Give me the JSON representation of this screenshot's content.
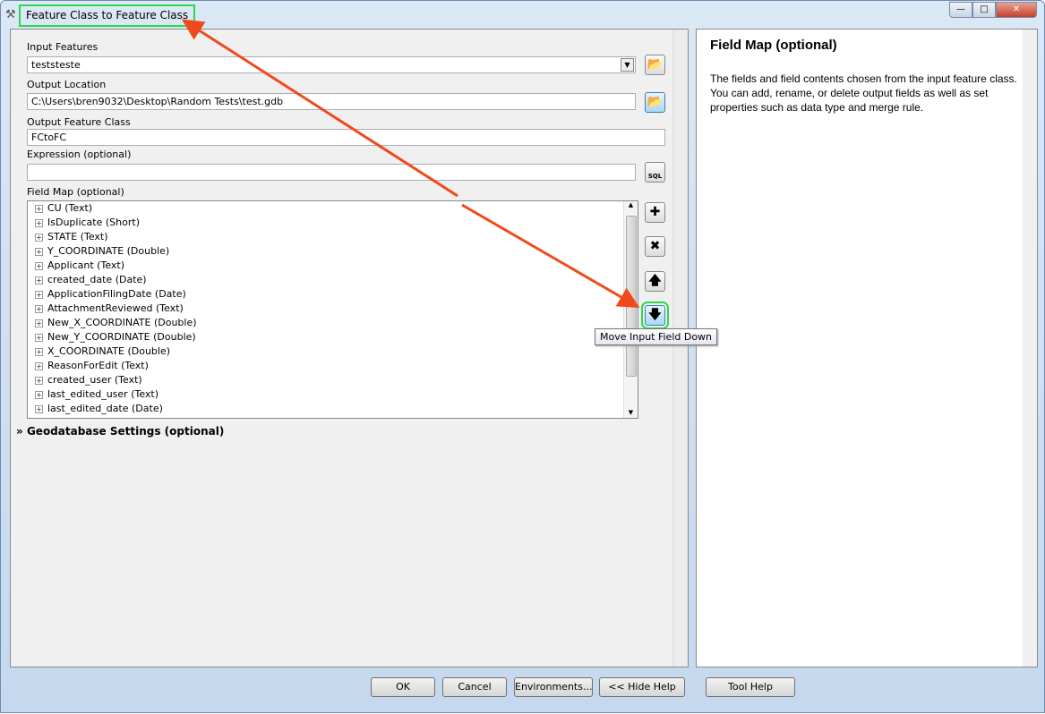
{
  "window": {
    "title": "Feature Class to Feature Class",
    "min": "—",
    "max": "□",
    "close": "✕"
  },
  "form": {
    "input_features": {
      "label": "Input Features",
      "value": "teststeste"
    },
    "output_location": {
      "label": "Output Location",
      "value": "C:\\Users\\bren9032\\Desktop\\Random Tests\\test.gdb"
    },
    "output_feature_class": {
      "label": "Output Feature Class",
      "value": "FCtoFC"
    },
    "expression": {
      "label": "Expression (optional)",
      "value": "",
      "sql": "SQL"
    },
    "field_map": {
      "label": "Field Map (optional)",
      "fields": [
        "CU (Text)",
        "IsDuplicate (Short)",
        "STATE (Text)",
        "Y_COORDINATE (Double)",
        "Applicant (Text)",
        "created_date (Date)",
        "ApplicationFilingDate (Date)",
        "AttachmentReviewed (Text)",
        "New_X_COORDINATE (Double)",
        "New_Y_COORDINATE (Double)",
        "X_COORDINATE (Double)",
        "ReasonForEdit (Text)",
        "created_user (Text)",
        "last_edited_user (Text)",
        "last_edited_date (Date)"
      ]
    },
    "geodatabase_settings": "Geodatabase Settings (optional)"
  },
  "tooltip": "Move Input Field Down",
  "help": {
    "title": "Field Map (optional)",
    "body": "The fields and field contents chosen from the input feature class. You can add, rename, or delete output fields as well as set properties such as data type and merge rule."
  },
  "buttons": {
    "ok": "OK",
    "cancel": "Cancel",
    "environments": "Environments...",
    "hide_help": "<< Hide Help",
    "tool_help": "Tool Help"
  },
  "colors": {
    "annotation_arrow": "#f04a1c",
    "highlight_box": "#2bd84a"
  }
}
